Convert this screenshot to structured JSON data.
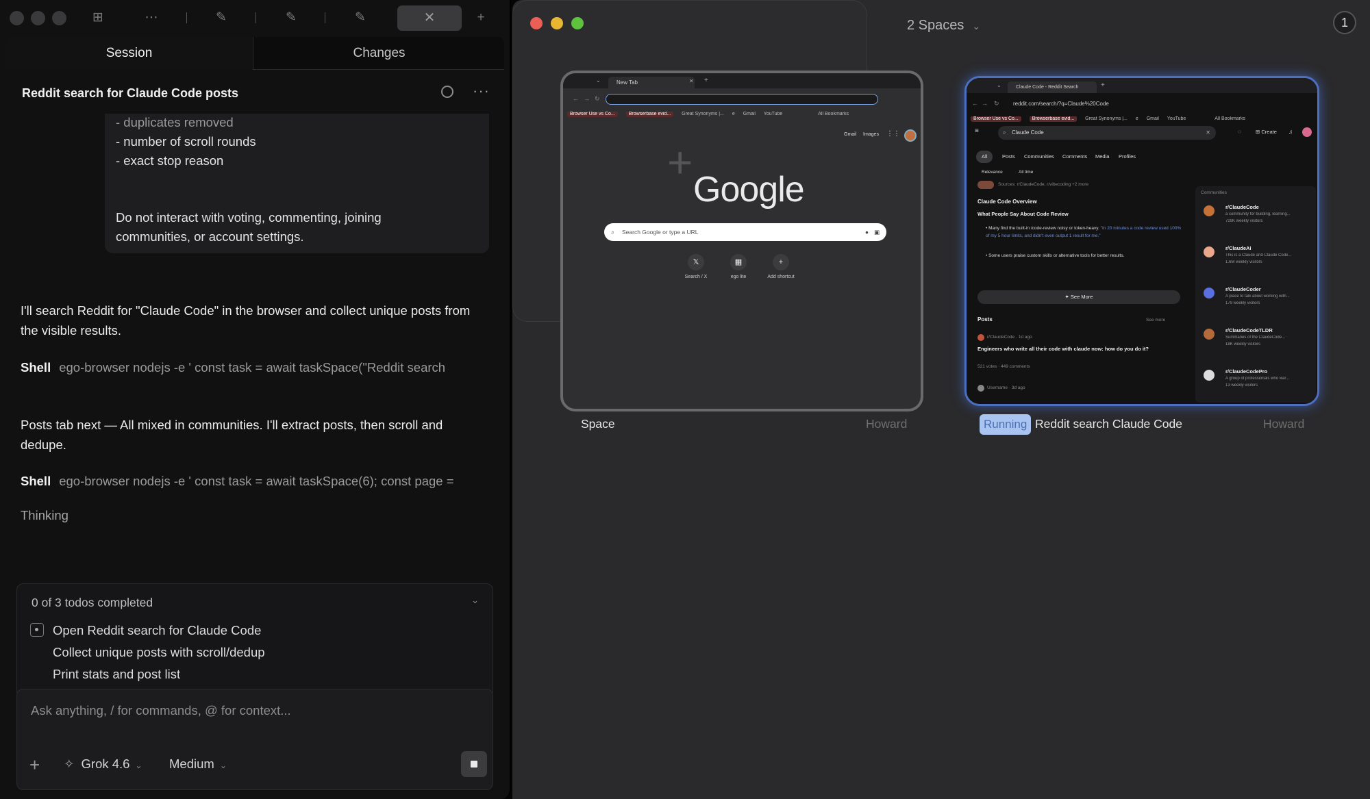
{
  "left": {
    "tabs": {
      "session": "Session",
      "changes": "Changes"
    },
    "session_title": "Reddit search for Claude Code posts",
    "message_box_lines": [
      "- duplicates removed",
      "- number of scroll rounds",
      "- exact stop reason",
      "Do not interact with voting, commenting, joining",
      "communities, or account settings."
    ],
    "para1": "I'll search Reddit for \"Claude Code\" in the browser and collect unique posts from the visible results.",
    "shell1": {
      "label": "Shell",
      "cmd": "ego-browser nodejs -e ' const task = await taskSpace(\"Reddit search"
    },
    "para2": "Posts tab next — All mixed in communities. I'll extract posts, then scroll and dedupe.",
    "shell2": {
      "label": "Shell",
      "cmd": "ego-browser nodejs -e ' const task = await taskSpace(6); const page ="
    },
    "thinking": "Thinking",
    "todos": {
      "summary": "0 of 3 todos completed",
      "items": [
        "Open Reddit search for Claude Code",
        "Collect unique posts with scroll/dedup",
        "Print stats and post list"
      ]
    },
    "composer": {
      "placeholder": "Ask anything, / for commands, @ for context...",
      "model": "Grok 4.6",
      "effort": "Medium"
    }
  },
  "right": {
    "spaces_title": "2 Spaces",
    "badge": "1",
    "card1": {
      "label": "Space",
      "owner": "Howard",
      "tab": "New Tab",
      "bookmarks": [
        "Browser Use vs Co...",
        "Browserbase evid...",
        "Great Synonyms |...",
        "e",
        "Gmail",
        "YouTube",
        "All Bookmarks"
      ],
      "top_links": [
        "Gmail",
        "Images"
      ],
      "logo": "Google",
      "search_placeholder": "Search Google or type a URL",
      "shortcuts": [
        "Search / X",
        "ego lite",
        "Add shortcut"
      ]
    },
    "card2": {
      "status": "Running",
      "label": "Reddit search Claude Code",
      "owner": "Howard",
      "tab": "Claude Code - Reddit Search",
      "url": "reddit.com/search/?q=Claude%20Code",
      "search": "Claude Code",
      "create": "Create",
      "filters": [
        "All",
        "Posts",
        "Communities",
        "Comments",
        "Media",
        "Profiles"
      ],
      "sort": [
        "Relevance",
        "All time"
      ],
      "sources": "Sources: r/ClaudeCode, r/vibecoding +2 more",
      "overview_title": "Claude Code Overview",
      "overview_sub": "What People Say About Code Review",
      "bullet1": "Many find the built-in /code-review noisy or token-heavy.",
      "bullet1_quote": "\"In 20 minutes a code review used 100% of my 5 hour limits, and didn't even output 1 result for me.\"",
      "bullet2": "Some users praise custom skills or alternative tools for better results.",
      "see_more": "See More",
      "posts_title": "Posts",
      "posts_see_more": "See more",
      "post_sub": "r/ClaudeCode · 1d ago",
      "post_title": "Engineers who write all their code with claude now: how do you do it?",
      "post_meta": "521 votes · 449 comments",
      "post2_sub": "Username · 3d ago",
      "communities_title": "Communities",
      "communities": [
        {
          "name": "r/ClaudeCode",
          "desc": "a community for building, learning...",
          "stats": "729K weekly visitors"
        },
        {
          "name": "r/ClaudeAI",
          "desc": "This is a Claude and Claude Code...",
          "stats": "1.6M weekly visitors"
        },
        {
          "name": "r/ClaudeCoder",
          "desc": "A place to talk about working with...",
          "stats": "179 weekly visitors"
        },
        {
          "name": "r/ClaudeCodeTLDR",
          "desc": "Summaries of the ClaudeCode...",
          "stats": "18K weekly visitors"
        },
        {
          "name": "r/ClaudeCodePro",
          "desc": "A group of professionals who war...",
          "stats": "13 weekly visitors"
        }
      ]
    }
  }
}
